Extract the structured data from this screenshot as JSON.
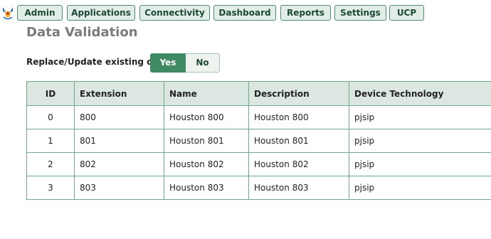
{
  "nav": {
    "items": [
      {
        "label": "Admin"
      },
      {
        "label": "Applications"
      },
      {
        "label": "Connectivity"
      },
      {
        "label": "Dashboard"
      },
      {
        "label": "Reports"
      },
      {
        "label": "Settings"
      },
      {
        "label": "UCP"
      }
    ]
  },
  "page": {
    "title": "Data Validation"
  },
  "replace": {
    "label": "Replace/Update existing data",
    "yes_label": "Yes",
    "no_label": "No",
    "selected": "Yes"
  },
  "table": {
    "headers": [
      "ID",
      "Extension",
      "Name",
      "Description",
      "Device Technology"
    ],
    "rows": [
      [
        "0",
        "800",
        "Houston 800",
        "Houston 800",
        "pjsip"
      ],
      [
        "1",
        "801",
        "Houston 801",
        "Houston 801",
        "pjsip"
      ],
      [
        "2",
        "802",
        "Houston 802",
        "Houston 802",
        "pjsip"
      ],
      [
        "3",
        "803",
        "Houston 803",
        "Houston 803",
        "pjsip"
      ]
    ]
  },
  "colors": {
    "accent": "#3f8a63",
    "nav_bg": "#e3ede7",
    "header_bg": "#dce7e1",
    "title_gray": "#7b7b7b"
  },
  "icons": {
    "logo": "freepbx-logo"
  }
}
